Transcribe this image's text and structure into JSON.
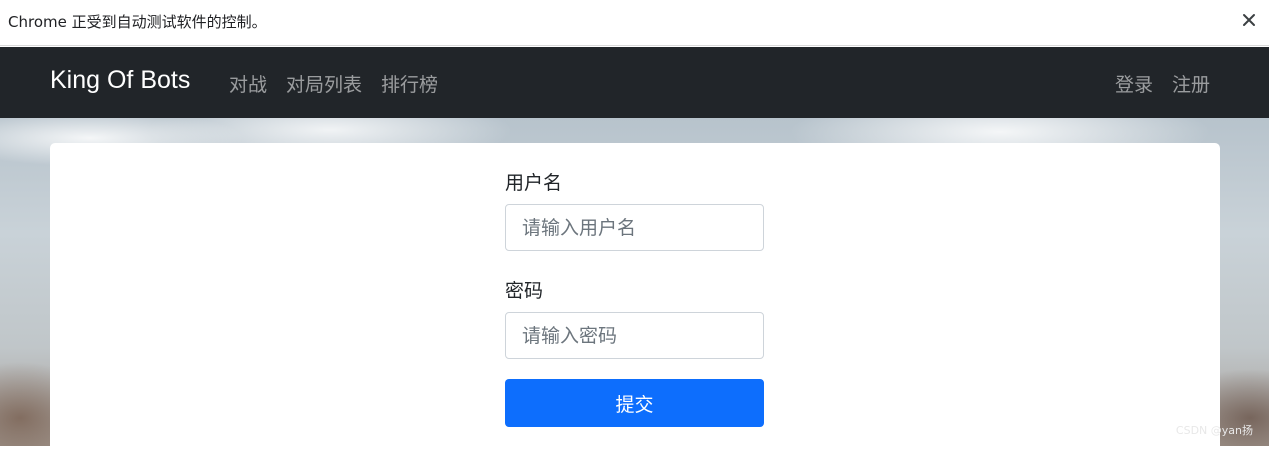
{
  "infobar": {
    "message": "Chrome 正受到自动测试软件的控制。",
    "close_icon": "close-icon"
  },
  "navbar": {
    "brand": "King Of Bots",
    "links": [
      "对战",
      "对局列表",
      "排行榜"
    ],
    "right_links": [
      "登录",
      "注册"
    ]
  },
  "form": {
    "username_label": "用户名",
    "username_placeholder": "请输入用户名",
    "username_value": "",
    "password_label": "密码",
    "password_placeholder": "请输入密码",
    "password_value": "",
    "submit_label": "提交"
  },
  "watermark": "CSDN @yan扬",
  "colors": {
    "navbar_bg": "#212529",
    "primary": "#0d6efd",
    "nav_link": "rgba(255,255,255,0.55)"
  }
}
